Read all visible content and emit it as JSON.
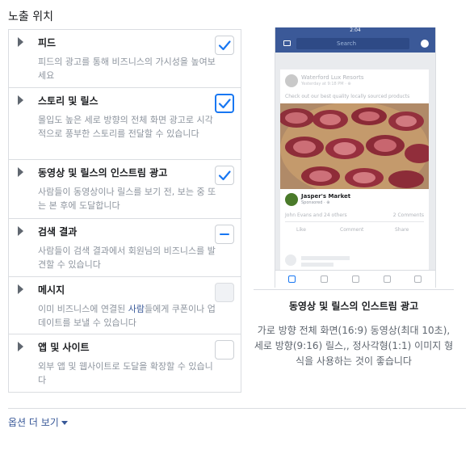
{
  "section_title": "노출 위치",
  "placements": [
    {
      "title": "피드",
      "description": "피드의 광고를 통해 비즈니스의 가시성을 높여보세요",
      "state": "checked"
    },
    {
      "title": "스토리 및 릴스",
      "description": "몰입도 높은 세로 방향의 전체 화면 광고로 시각적으로 풍부한 스토리를 전달할 수 있습니다",
      "state": "checked"
    },
    {
      "title": "동영상 및 릴스의 인스트림 광고",
      "description": "사람들이 동영상이나 릴스를 보기 전, 보는 중 또는 본 후에 도달합니다",
      "state": "checked"
    },
    {
      "title": "검색 결과",
      "description": "사람들이 검색 결과에서 회원님의 비즈니스를 발견할 수 있습니다",
      "state": "indeterminate"
    },
    {
      "title": "메시지",
      "description_before": "이미 비즈니스에 연결된 ",
      "description_link": "사람",
      "description_after": "들에게 쿠폰이나 업데이트를 보낼 수 있습니다",
      "state": "disabled"
    },
    {
      "title": "앱 및 사이트",
      "description": "외부 앱 및 웹사이트로 도달을 확장할 수 있습니다",
      "state": "unchecked"
    }
  ],
  "preview": {
    "phone": {
      "time": "2:04",
      "search_placeholder": "Search",
      "page_name": "Waterford Lux Resorts",
      "page_sub": "Yesterday at 9:18 PM · ⊕",
      "post_text": "Check out our best quality locally sourced products",
      "advertiser_name": "Jasper's Market",
      "advertiser_sub": "Sponsored · ⊕",
      "reactions_text": "John Evans and 24 others",
      "comments_text": "2 Comments",
      "like_label": "Like",
      "comment_label": "Comment",
      "share_label": "Share"
    },
    "title": "동영상 및 릴스의 인스트림 광고",
    "description": "가로 방향 전체 화면(16:9) 동영상(최대 10초), 세로 방향(9:16) 릴스,, 정사각형(1:1) 이미지 형식을 사용하는 것이 좋습니다"
  },
  "more_options_label": "옵션 더 보기",
  "colors": {
    "accent": "#1877f2",
    "link": "#385898",
    "border": "#dadde1",
    "muted_text": "#8d949e",
    "facebook_blue": "#3b5998"
  }
}
